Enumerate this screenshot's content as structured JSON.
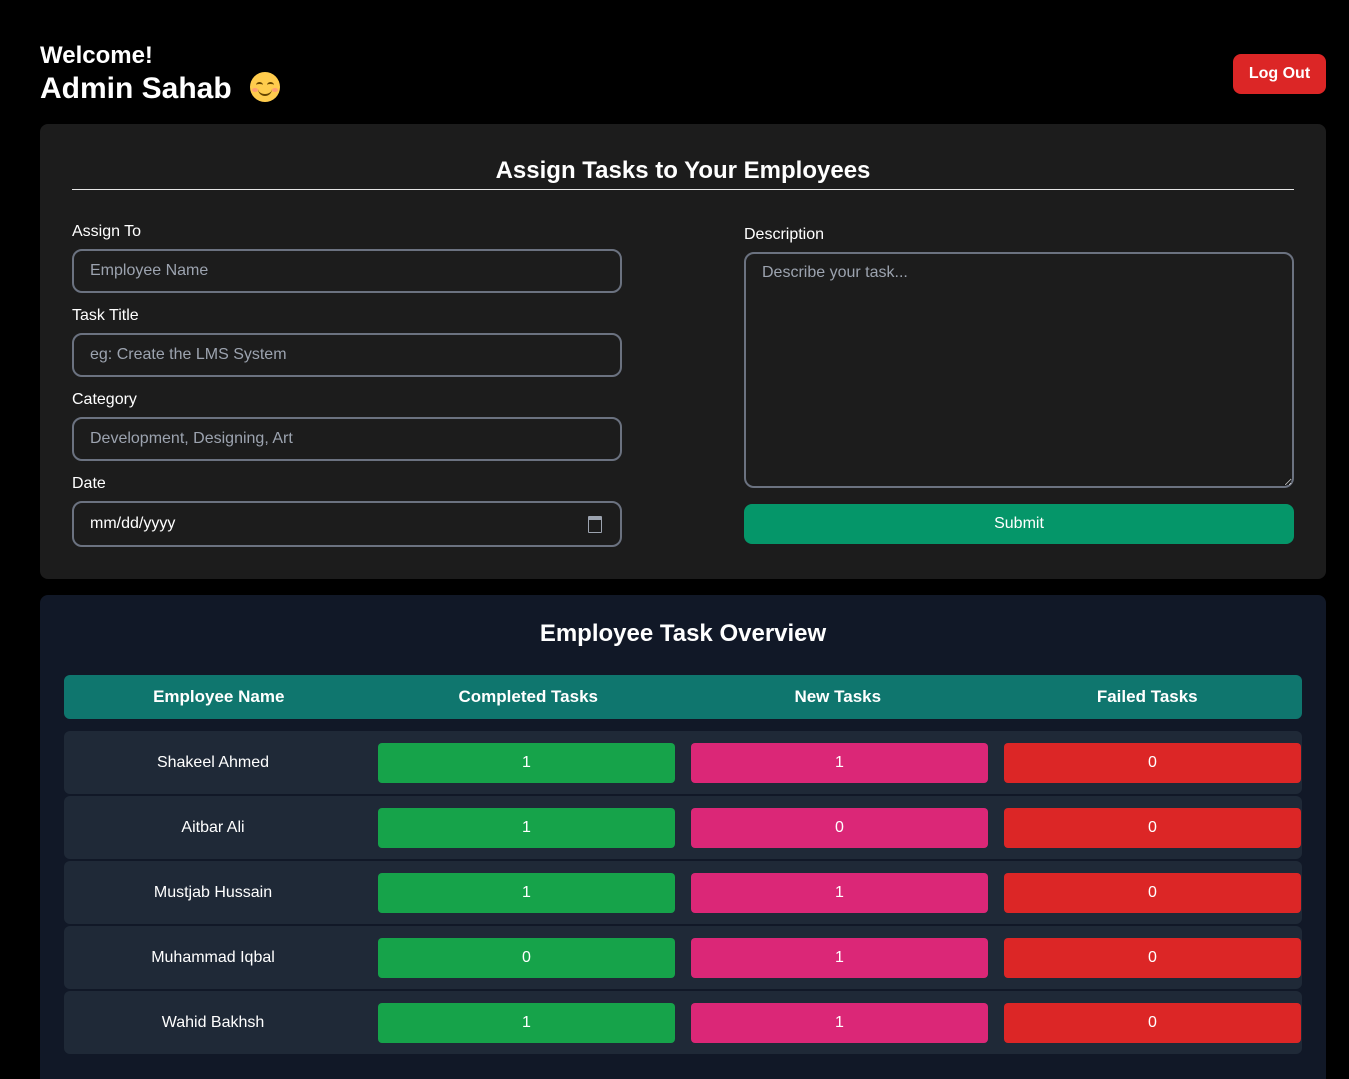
{
  "header": {
    "welcome": "Welcome!",
    "admin_name": "Admin Sahab",
    "emoji_icon": "smiling-face-icon",
    "logout_label": "Log Out"
  },
  "assign_form": {
    "title": "Assign Tasks to Your Employees",
    "assign_to": {
      "label": "Assign To",
      "placeholder": "Employee Name",
      "value": ""
    },
    "task_title": {
      "label": "Task Title",
      "placeholder": "eg: Create the LMS System",
      "value": ""
    },
    "category": {
      "label": "Category",
      "placeholder": "Development, Designing, Art",
      "value": ""
    },
    "date": {
      "label": "Date",
      "placeholder": "mm/dd/yyyy",
      "value": ""
    },
    "description": {
      "label": "Description",
      "placeholder": "Describe your task...",
      "value": ""
    },
    "submit_label": "Submit"
  },
  "overview": {
    "title": "Employee Task Overview",
    "columns": [
      "Employee Name",
      "Completed Tasks",
      "New Tasks",
      "Failed Tasks"
    ],
    "rows": [
      {
        "name": "Shakeel Ahmed",
        "completed": "1",
        "new": "1",
        "failed": "0"
      },
      {
        "name": "Aitbar Ali",
        "completed": "1",
        "new": "0",
        "failed": "0"
      },
      {
        "name": "Mustjab Hussain",
        "completed": "1",
        "new": "1",
        "failed": "0"
      },
      {
        "name": "Muhammad Iqbal",
        "completed": "0",
        "new": "1",
        "failed": "0"
      },
      {
        "name": "Wahid Bakhsh",
        "completed": "1",
        "new": "1",
        "failed": "0"
      }
    ]
  },
  "colors": {
    "background": "#000000",
    "panel": "#1c1c1c",
    "overview_panel": "#111827",
    "header_row": "#0f766e",
    "completed": "#16a34a",
    "new": "#db2777",
    "failed": "#dc2626",
    "submit": "#059669",
    "logout": "#dc2626"
  }
}
